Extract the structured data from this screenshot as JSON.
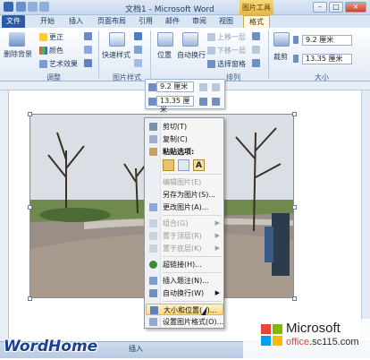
{
  "titlebar": {
    "title": "文档1 - Microsoft Word",
    "context_label": "图片工具",
    "min": "–",
    "max": "□",
    "close": "×"
  },
  "tabs": [
    "文件",
    "开始",
    "插入",
    "页面布局",
    "引用",
    "邮件",
    "审阅",
    "视图",
    "格式"
  ],
  "ribbon": {
    "remove_bg": "删除背景",
    "correct": "更正",
    "color": "颜色",
    "artistic": "艺术效果",
    "adjust_group": "调整",
    "quick_styles": "快速样式",
    "pic_styles_group": "图片样式",
    "position": "位置",
    "wrap_text": "自动换行",
    "bring_forward": "上移一层",
    "send_backward": "下移一层",
    "selection_pane": "选择窗格",
    "arrange_group": "排列",
    "crop": "裁剪",
    "height": "9.2 厘米",
    "width": "13.35 厘米",
    "size_group": "大小"
  },
  "minitoolbar": {
    "height": "9.2 厘米",
    "width": "13.35 厘米"
  },
  "context_menu": {
    "items": [
      {
        "label": "剪切(T)",
        "enabled": true
      },
      {
        "label": "复制(C)",
        "enabled": true
      },
      {
        "label": "粘贴选项:",
        "enabled": true
      },
      {
        "label": "编辑图片(E)",
        "enabled": false
      },
      {
        "label": "另存为图片(S)...",
        "enabled": true
      },
      {
        "label": "更改图片(A)...",
        "enabled": true
      },
      {
        "label": "组合(G)",
        "enabled": false
      },
      {
        "label": "置于顶层(R)",
        "enabled": false
      },
      {
        "label": "置于底层(K)",
        "enabled": false
      },
      {
        "label": "超链接(H)...",
        "enabled": true
      },
      {
        "label": "插入题注(N)...",
        "enabled": true
      },
      {
        "label": "自动换行(W)",
        "enabled": true
      },
      {
        "label": "大小和位置(Z)...",
        "enabled": true
      },
      {
        "label": "设置图片格式(O)...",
        "enabled": true
      }
    ]
  },
  "statusbar": {
    "insert": "插入",
    "brand": "WordHome"
  },
  "watermark": {
    "ms": "Microsoft",
    "site_a": "office",
    "site_b": ".sc115.com"
  },
  "colors": {
    "file_tab": "#2a5aa8",
    "context_tab": "#e8b441",
    "highlight": "#ffd978",
    "office_red": "#e8453c",
    "office_green": "#7cbb00",
    "office_blue": "#00a1f1",
    "office_yellow": "#ffbb00"
  },
  "icons": [
    "save-icon",
    "undo-icon",
    "redo-icon",
    "scissors-icon",
    "copy-icon",
    "paste-icon",
    "picture-icon",
    "hyperlink-icon",
    "caption-icon",
    "wrap-icon",
    "size-icon",
    "format-icon",
    "cursor-icon"
  ]
}
